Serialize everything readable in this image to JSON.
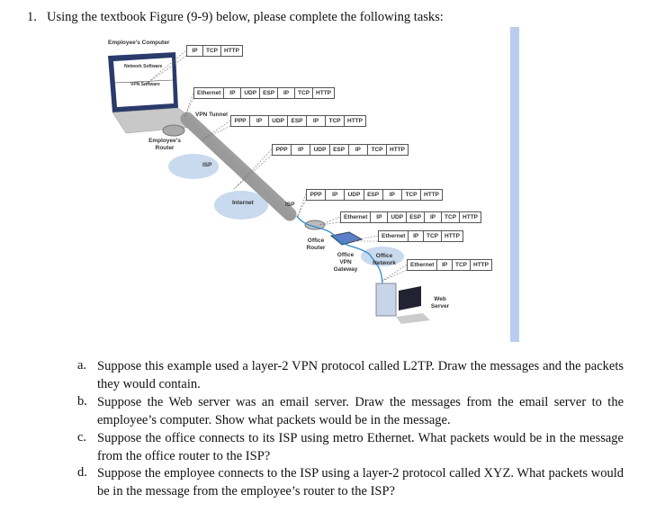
{
  "question": {
    "number": "1.",
    "text": "Using the textbook Figure (9-9) below, please complete the following tasks:"
  },
  "figure": {
    "labels": {
      "employee_computer": "Employee's Computer",
      "network_software": "Network Software",
      "vpn_software": "VPN Software",
      "vpn_tunnel": "VPN Tunnel",
      "employee_router": "Employee's Router",
      "isp1": "ISP",
      "internet": "Internet",
      "isp2": "ISP",
      "office_router": "Office Router",
      "office_vpn_gateway": "Office VPN Gateway",
      "office_network": "Office Network",
      "web_server": "Web Server"
    },
    "packets": [
      [
        "IP",
        "TCP",
        "HTTP"
      ],
      [
        "Ethernet",
        "IP",
        "UDP",
        "ESP",
        "IP",
        "TCP",
        "HTTP"
      ],
      [
        "PPP",
        "IP",
        "UDP",
        "ESP",
        "IP",
        "TCP",
        "HTTP"
      ],
      [
        "PPP",
        "IP",
        "UDP",
        "ESP",
        "IP",
        "TCP",
        "HTTP"
      ],
      [
        "PPP",
        "IP",
        "UDP",
        "ESP",
        "IP",
        "TCP",
        "HTTP"
      ],
      [
        "Ethernet",
        "IP",
        "UDP",
        "ESP",
        "IP",
        "TCP",
        "HTTP"
      ],
      [
        "Ethernet",
        "IP",
        "TCP",
        "HTTP"
      ],
      [
        "Ethernet",
        "IP",
        "TCP",
        "HTTP"
      ]
    ]
  },
  "tasks": [
    {
      "letter": "a.",
      "text": "Suppose this example used a layer-2 VPN protocol called L2TP. Draw the messages and the packets they would contain."
    },
    {
      "letter": "b.",
      "text": "Suppose the Web server was an email server. Draw the messages from the email server to the employee’s computer. Show what packets would be in the message."
    },
    {
      "letter": "c.",
      "text": "Suppose the office connects to its ISP using metro Ethernet. What packets would be in the message from the office router to the ISP?"
    },
    {
      "letter": "d.",
      "text": "Suppose the employee connects to the ISP using a layer-2 protocol called XYZ. What packets would be in the message from the employee’s router to the ISP?"
    }
  ]
}
